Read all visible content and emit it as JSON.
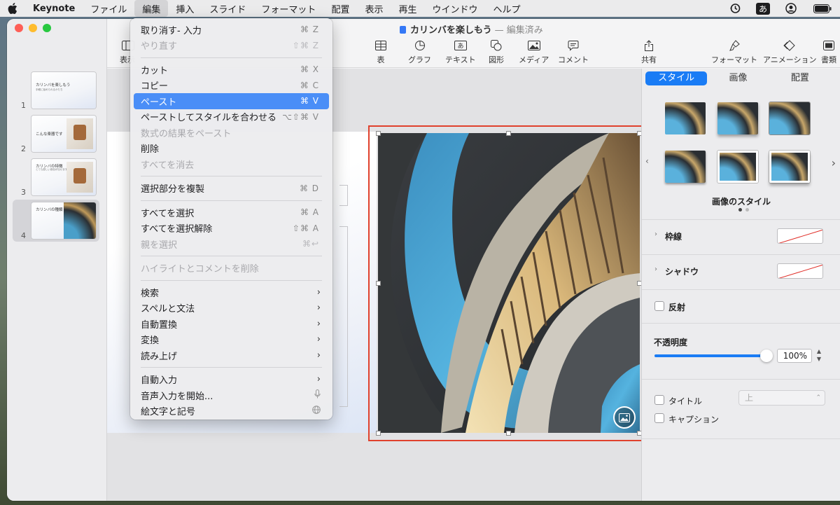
{
  "menubar": {
    "app": "Keynote",
    "items": [
      "ファイル",
      "編集",
      "挿入",
      "スライド",
      "フォーマット",
      "配置",
      "表示",
      "再生",
      "ウインドウ",
      "ヘルプ"
    ],
    "active_index": 1,
    "input_method": "あ"
  },
  "window": {
    "title": "カリンバを楽しもう",
    "title_status": "— 編集済み"
  },
  "toolbar": {
    "left_label": "表示",
    "items": [
      "表",
      "グラフ",
      "テキスト",
      "図形",
      "メディア",
      "コメント"
    ],
    "share_label": "共有",
    "format_label": "フォーマット",
    "animation_label": "アニメーション",
    "document_label": "書類"
  },
  "slides": [
    {
      "num": "1",
      "title": "カリンバを楽しもう",
      "subtitle": "手軽に始められるかたち"
    },
    {
      "num": "2",
      "title": "こんな楽器です",
      "subtitle": ""
    },
    {
      "num": "3",
      "title": "カリンバの特徴",
      "subtitle": "とても優しい音色が出せます"
    },
    {
      "num": "4",
      "title": "カリンバの種類",
      "subtitle": ""
    }
  ],
  "edit_menu": [
    {
      "type": "item",
      "label": "取り消す- 入力",
      "shortcut": "⌘ Z",
      "enabled": true
    },
    {
      "type": "item",
      "label": "やり直す",
      "shortcut": "⇧⌘ Z",
      "enabled": false
    },
    {
      "type": "sep"
    },
    {
      "type": "item",
      "label": "カット",
      "shortcut": "⌘ X",
      "enabled": true
    },
    {
      "type": "item",
      "label": "コピー",
      "shortcut": "⌘ C",
      "enabled": true
    },
    {
      "type": "item",
      "label": "ペースト",
      "shortcut": "⌘ V",
      "enabled": true,
      "highlighted": true
    },
    {
      "type": "item",
      "label": "ペーストしてスタイルを合わせる",
      "shortcut": "⌥⇧⌘ V",
      "enabled": true
    },
    {
      "type": "item",
      "label": "数式の結果をペースト",
      "shortcut": "",
      "enabled": false
    },
    {
      "type": "item",
      "label": "削除",
      "shortcut": "",
      "enabled": true
    },
    {
      "type": "item",
      "label": "すべてを消去",
      "shortcut": "",
      "enabled": false
    },
    {
      "type": "sep"
    },
    {
      "type": "item",
      "label": "選択部分を複製",
      "shortcut": "⌘ D",
      "enabled": true
    },
    {
      "type": "sep"
    },
    {
      "type": "item",
      "label": "すべてを選択",
      "shortcut": "⌘ A",
      "enabled": true
    },
    {
      "type": "item",
      "label": "すべてを選択解除",
      "shortcut": "⇧⌘ A",
      "enabled": true
    },
    {
      "type": "item",
      "label": "親を選択",
      "shortcut": "⌘↩",
      "enabled": false
    },
    {
      "type": "sep"
    },
    {
      "type": "item",
      "label": "ハイライトとコメントを削除",
      "shortcut": "",
      "enabled": false
    },
    {
      "type": "sep"
    },
    {
      "type": "item",
      "label": "検索",
      "submenu": true,
      "enabled": true
    },
    {
      "type": "item",
      "label": "スペルと文法",
      "submenu": true,
      "enabled": true
    },
    {
      "type": "item",
      "label": "自動置換",
      "submenu": true,
      "enabled": true
    },
    {
      "type": "item",
      "label": "変換",
      "submenu": true,
      "enabled": true
    },
    {
      "type": "item",
      "label": "読み上げ",
      "submenu": true,
      "enabled": true
    },
    {
      "type": "sep"
    },
    {
      "type": "item",
      "label": "自動入力",
      "submenu": true,
      "enabled": true
    },
    {
      "type": "item",
      "label": "音声入力を開始...",
      "icon": "mic-icon",
      "enabled": true
    },
    {
      "type": "item",
      "label": "絵文字と記号",
      "icon": "globe-icon",
      "enabled": true
    }
  ],
  "inspector": {
    "tabs": [
      "スタイル",
      "画像",
      "配置"
    ],
    "active_tab": 0,
    "styles_label": "画像のスタイル",
    "border_label": "枠線",
    "shadow_label": "シャドウ",
    "reflection_label": "反射",
    "opacity_label": "不透明度",
    "opacity_value": "100%",
    "opacity_fraction": 1.0,
    "title_label": "タイトル",
    "title_position": "上",
    "caption_label": "キャプション"
  },
  "colors": {
    "accent": "#1a7cf5",
    "menu_highlight": "#4a8ef7",
    "selection_frame": "#e0412d"
  }
}
